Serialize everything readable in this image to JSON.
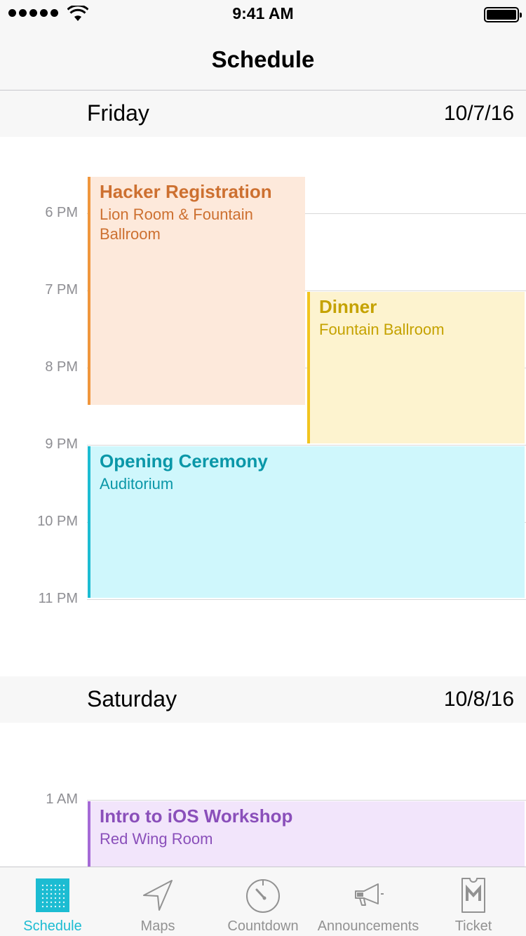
{
  "status_bar": {
    "time": "9:41 AM",
    "signal_icon": "signal-dots-icon",
    "wifi_icon": "wifi-icon",
    "battery_icon": "battery-icon"
  },
  "nav": {
    "title": "Schedule"
  },
  "days": [
    {
      "name": "Friday",
      "date": "10/7/16",
      "hours": [
        "6 PM",
        "7 PM",
        "8 PM",
        "9 PM",
        "10 PM",
        "11 PM"
      ],
      "events": [
        {
          "title": "Hacker Registration",
          "location": "Lion Room & Fountain Ballroom",
          "color": "#f0963c"
        },
        {
          "title": "Dinner",
          "location": "Fountain Ballroom",
          "color": "#f1c41f"
        },
        {
          "title": "Opening Ceremony",
          "location": "Auditorium",
          "color": "#1cbcd2"
        }
      ]
    },
    {
      "name": "Saturday",
      "date": "10/8/16",
      "hours": [
        "1 AM"
      ],
      "events": [
        {
          "title": "Intro to iOS Workshop",
          "location": "Red Wing Room",
          "color": "#a56ad6"
        }
      ]
    }
  ],
  "tabs": [
    {
      "label": "Schedule",
      "icon": "schedule-grid-icon",
      "active": true
    },
    {
      "label": "Maps",
      "icon": "navigation-arrow-icon",
      "active": false
    },
    {
      "label": "Countdown",
      "icon": "timer-icon",
      "active": false
    },
    {
      "label": "Announcements",
      "icon": "megaphone-icon",
      "active": false
    },
    {
      "label": "Ticket",
      "icon": "ticket-icon",
      "active": false
    }
  ],
  "colors": {
    "accent": "#1cbcd2",
    "inactive_tab": "#929292"
  }
}
